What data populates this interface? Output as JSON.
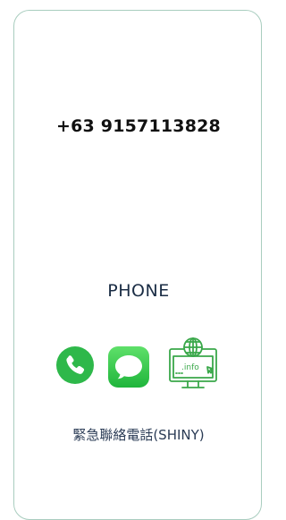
{
  "contact": {
    "phone_number": "+63 9157113828",
    "section_title": "PHONE",
    "caption": "緊急聯絡電話(SHINY)"
  },
  "icons": [
    {
      "name": "phone-call-icon",
      "color": "#2eb84a"
    },
    {
      "name": "message-bubble-icon",
      "color": "#2fc24a"
    },
    {
      "name": "website-info-icon",
      "color": "#3aa84a",
      "label": ".info"
    }
  ]
}
